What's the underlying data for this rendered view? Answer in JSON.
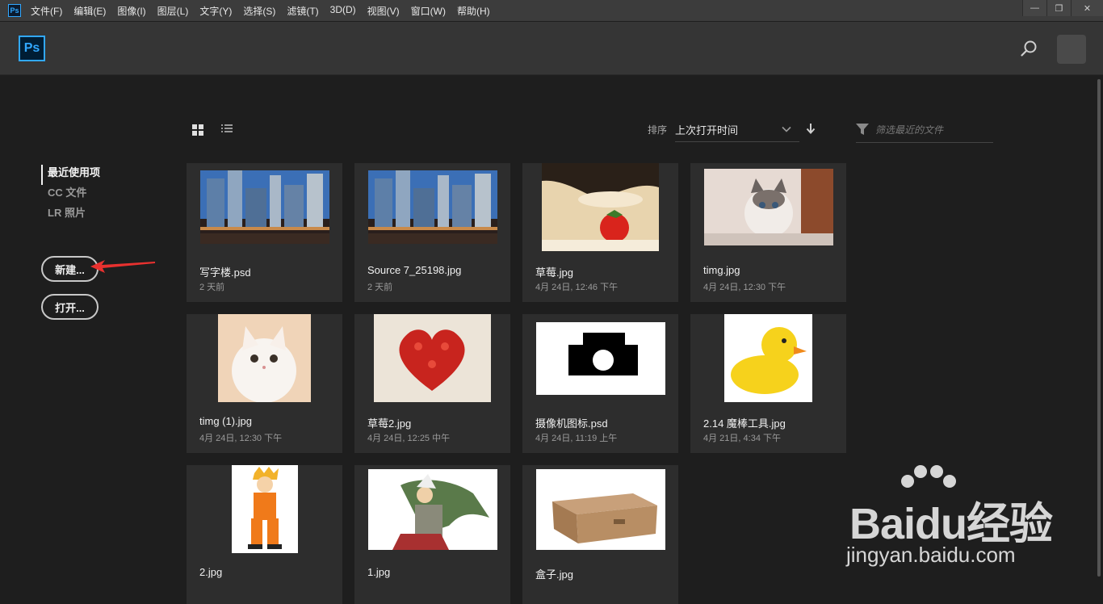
{
  "app": {
    "icon_label": "Ps"
  },
  "menu": [
    "文件(F)",
    "编辑(E)",
    "图像(I)",
    "图层(L)",
    "文字(Y)",
    "选择(S)",
    "滤镜(T)",
    "3D(D)",
    "视图(V)",
    "窗口(W)",
    "帮助(H)"
  ],
  "window_controls": {
    "minimize": "—",
    "restore": "❐",
    "close": "✕"
  },
  "header": {
    "logo_text": "Ps"
  },
  "toolbar": {
    "sort_label": "排序",
    "sort_value": "上次打开时间",
    "filter_placeholder": "筛选最近的文件"
  },
  "sidebar": {
    "items": [
      {
        "label": "最近使用项",
        "active": true
      },
      {
        "label": "CC 文件",
        "active": false
      },
      {
        "label": "LR 照片",
        "active": false
      }
    ],
    "new_button": "新建...",
    "open_button": "打开..."
  },
  "files": [
    {
      "name": "写字楼.psd",
      "date": "2 天前",
      "thumb": "city"
    },
    {
      "name": "Source 7_25198.jpg",
      "date": "2 天前",
      "thumb": "city"
    },
    {
      "name": "草莓.jpg",
      "date": "4月 24日, 12:46 下午",
      "thumb": "strawberry"
    },
    {
      "name": "timg.jpg",
      "date": "4月 24日, 12:30 下午",
      "thumb": "cat-gray"
    },
    {
      "name": "timg (1).jpg",
      "date": "4月 24日, 12:30 下午",
      "thumb": "cat-white"
    },
    {
      "name": "草莓2.jpg",
      "date": "4月 24日, 12:25 中午",
      "thumb": "heart"
    },
    {
      "name": "摄像机图标.psd",
      "date": "4月 24日, 11:19 上午",
      "thumb": "camera"
    },
    {
      "name": "2.14 魔棒工具.jpg",
      "date": "4月 21日, 4:34 下午",
      "thumb": "duck"
    },
    {
      "name": "2.jpg",
      "date": "",
      "thumb": "naruto"
    },
    {
      "name": "1.jpg",
      "date": "",
      "thumb": "jiraiya"
    },
    {
      "name": "盒子.jpg",
      "date": "",
      "thumb": "box"
    }
  ],
  "watermark": {
    "brand": "Baidu经验",
    "url": "jingyan.baidu.com"
  },
  "colors": {
    "accent": "#31a8ff",
    "annotation_arrow": "#e8312f"
  }
}
